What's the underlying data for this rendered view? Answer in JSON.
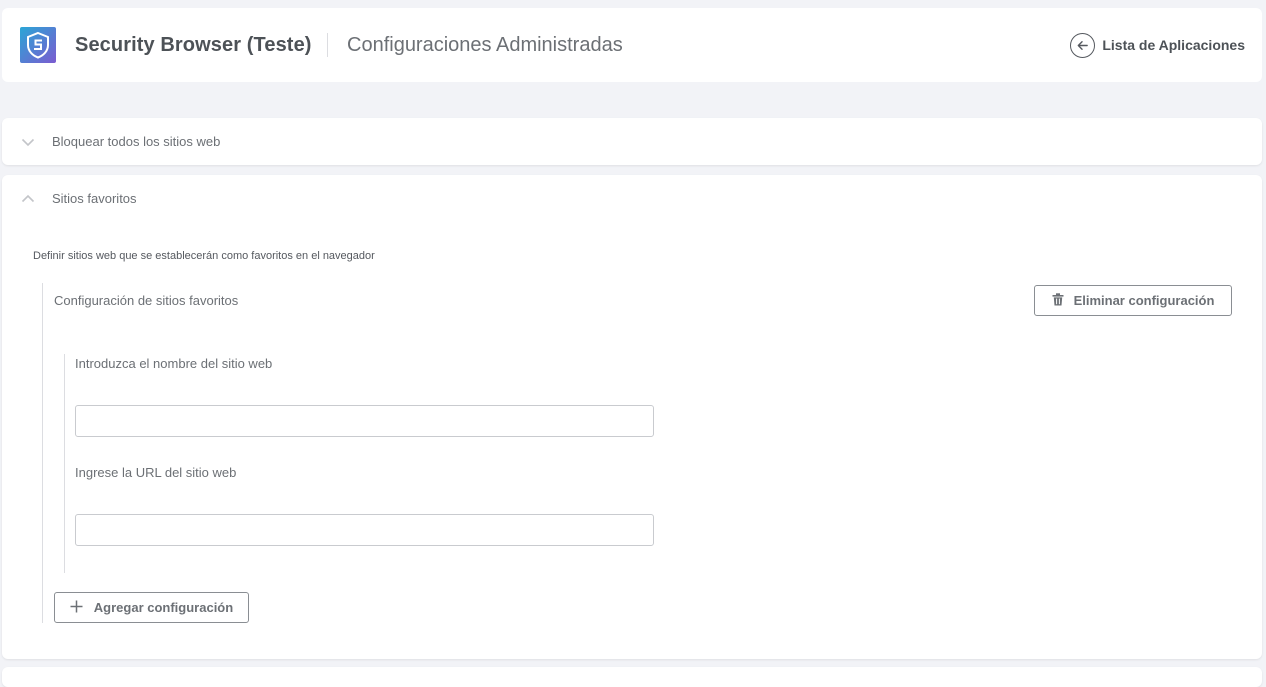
{
  "header": {
    "app_name": "Security Browser (Teste)",
    "page_title": "Configuraciones Administradas",
    "back_label": "Lista de Aplicaciones",
    "logo_icon": "shield-s-logo",
    "colors": {
      "logo_top": "#2aa6d6",
      "logo_bottom": "#7b5bd0"
    }
  },
  "sections": [
    {
      "title": "Bloquear todos los sitios web",
      "expanded": false
    },
    {
      "title": "Sitios favoritos",
      "expanded": true,
      "description": "Definir sitios web que se establecerán como favoritos en el navegador",
      "config": {
        "title": "Configuración de sitios favoritos",
        "delete_label": "Eliminar configuración",
        "fields": [
          {
            "label": "Introduzca el nombre del sitio web",
            "value": ""
          },
          {
            "label": "Ingrese la URL del sitio web",
            "value": ""
          }
        ],
        "add_label": "Agregar configuración"
      }
    }
  ]
}
